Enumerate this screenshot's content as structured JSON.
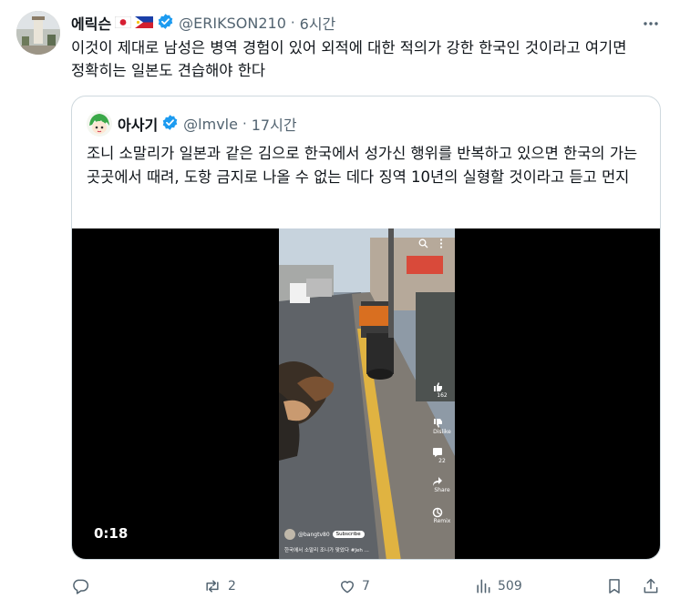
{
  "tweet": {
    "author_name": "에릭슨",
    "handle": "@ERIKSON210",
    "time": "6시간",
    "text": "이것이 제대로 남성은 병역 경험이 있어 외적에 대한 적의가 강한 한국인 것이라고 여기면 정확히는 일본도 견습해야 한다",
    "separator": "·"
  },
  "quote": {
    "author_name": "아사기",
    "handle": "@lmvle",
    "time": "17시간",
    "separator": "·",
    "text": "조니 소말리가 일본과 같은 김으로 한국에서 성가신 행위를 반복하고 있으면 한국의 가는 곳곳에서 때려, 도항 금지로 나올 수 없는 데다 징역 10년의 실형할 것이라고 듣고 먼지",
    "video": {
      "duration": "0:18",
      "overlay": {
        "likes": "162",
        "dislike": "Dislike",
        "comments": "22",
        "share": "Share",
        "remix": "Remix",
        "channel": "@bangtv80",
        "subscribe": "Subscribe",
        "caption": "한국에서 소말리 조니가 맞았다 #Jeh ..."
      }
    }
  },
  "actions": {
    "replies": "",
    "reposts": "2",
    "likes": "7",
    "views": "509"
  },
  "colors": {
    "text": "#0f1419",
    "secondary": "#536471",
    "border": "#cfd9de",
    "verified": "#1d9bf0"
  }
}
